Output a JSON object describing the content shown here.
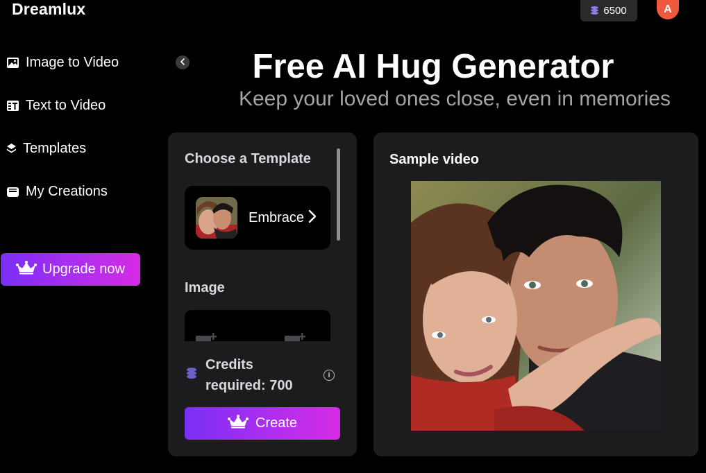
{
  "app": {
    "logo": "Dreamlux"
  },
  "header": {
    "credits_balance": "6500",
    "avatar_initial": "A"
  },
  "sidebar": {
    "items": [
      {
        "label": "Image to Video",
        "icon": "image-icon"
      },
      {
        "label": "Text to Video",
        "icon": "text-video-icon"
      },
      {
        "label": "Templates",
        "icon": "layers-icon"
      },
      {
        "label": "My Creations",
        "icon": "folder-icon"
      }
    ],
    "upgrade_label": "Upgrade now"
  },
  "hero": {
    "title": "Free AI Hug Generator",
    "subtitle": "Keep your loved ones close, even in memories"
  },
  "form": {
    "template_heading": "Choose a Template",
    "template_name": "Embrace",
    "image_heading": "Image",
    "credits_label": "Credits required: 700",
    "create_label": "Create"
  },
  "preview": {
    "title": "Sample video"
  },
  "colors": {
    "accent_start": "#7b2ff7",
    "accent_end": "#d72ce6",
    "avatar": "#f05a3c",
    "panel": "#1c1c1e"
  }
}
